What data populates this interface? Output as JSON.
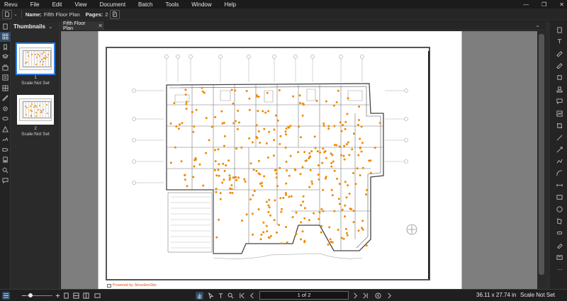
{
  "app": {
    "menu": [
      "Revu",
      "File",
      "Edit",
      "View",
      "Document",
      "Batch",
      "Tools",
      "Window",
      "Help"
    ]
  },
  "properties": {
    "name_label": "Name:",
    "name_value": "Fifth Floor Plan",
    "pages_label": "Pages:",
    "pages_value": "2"
  },
  "thumbnails": {
    "title": "Thumbnails",
    "items": [
      {
        "number": "1",
        "scale": "Scale:Not Set",
        "selected": true
      },
      {
        "number": "2",
        "scale": "Scale:Not Set",
        "selected": false
      }
    ]
  },
  "tabs": [
    {
      "label": "Fifth Floor Plan",
      "close": "✕"
    }
  ],
  "document": {
    "footer_text": "Powered by StructionSite"
  },
  "status": {
    "page_indicator": "1 of 2",
    "dimensions": "36.11 x 27.74 in",
    "scale": "Scale Not Set"
  },
  "colors": {
    "accent": "#2f7de1",
    "marker": "#f08a00",
    "footer_text": "#d9531e"
  }
}
